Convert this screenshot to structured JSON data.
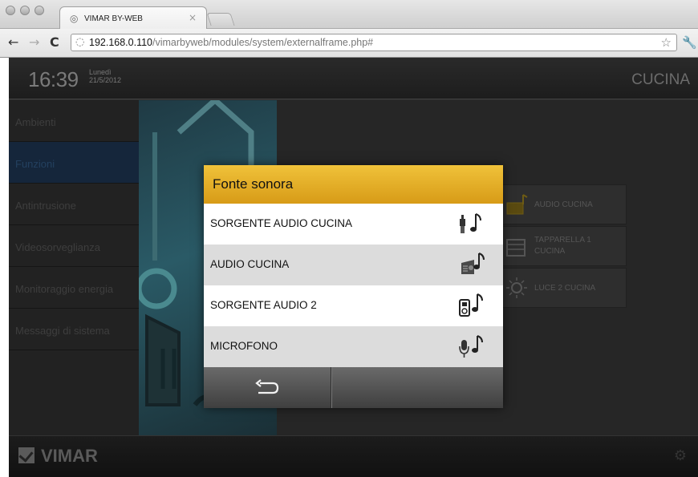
{
  "browser": {
    "tab_title": "VIMAR BY-WEB",
    "tab_close": "×",
    "url_host": "192.168.0.110",
    "url_path": "/vimarbyweb/modules/system/externalframe.php#"
  },
  "header": {
    "time": "16:39",
    "weekday": "Lunedì",
    "date": "21/5/2012",
    "room": "CUCINA"
  },
  "sidebar": {
    "items": [
      {
        "label": "Ambienti"
      },
      {
        "label": "Funzioni"
      },
      {
        "label": "Antintrusione"
      },
      {
        "label": "Videosorveglianza"
      },
      {
        "label": "Monitoraggio energia"
      },
      {
        "label": "Messaggi di sistema"
      }
    ],
    "active_index": 1
  },
  "tiles": [
    {
      "label": "AUDIO CUCINA",
      "icon": "radio-icon"
    },
    {
      "label": "TAPPARELLA 1 CUCINA",
      "icon": "shutter-icon"
    },
    {
      "label": "LUCE 2 CUCINA",
      "icon": "bulb-icon"
    }
  ],
  "footer": {
    "brand": "VIMAR"
  },
  "modal": {
    "title": "Fonte sonora",
    "items": [
      {
        "label": "SORGENTE AUDIO CUCINA",
        "icon": "rca-plug-music-icon"
      },
      {
        "label": "AUDIO CUCINA",
        "icon": "radio-music-icon"
      },
      {
        "label": "SORGENTE AUDIO 2",
        "icon": "ipod-music-icon"
      },
      {
        "label": "MICROFONO",
        "icon": "microphone-music-icon"
      }
    ],
    "back_icon": "back-arrow-icon"
  },
  "colors": {
    "modal_header": "#e5ad26",
    "row_odd": "#ffffff",
    "row_even": "#dcdcdc",
    "active_sidebar": "#15263b"
  }
}
